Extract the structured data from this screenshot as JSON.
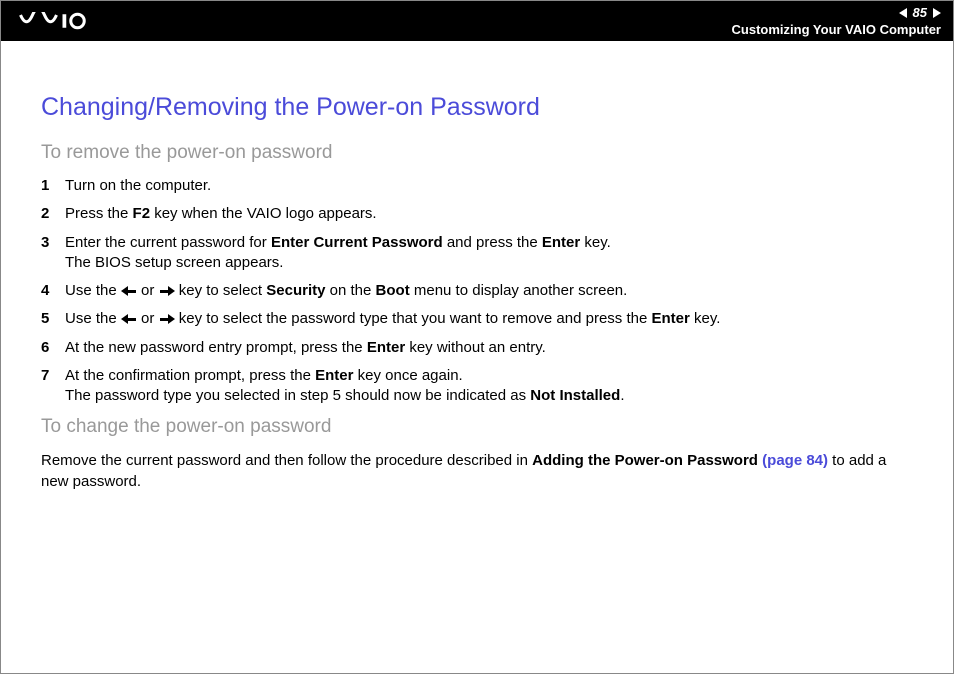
{
  "header": {
    "page_number": "85",
    "breadcrumb": "Customizing Your VAIO Computer"
  },
  "title": "Changing/Removing the Power-on Password",
  "section_remove": {
    "heading": "To remove the power-on password",
    "steps": [
      {
        "num": "1",
        "text": "Turn on the computer."
      },
      {
        "num": "2",
        "pre": "Press the ",
        "b1": "F2",
        "post": " key when the VAIO logo appears."
      },
      {
        "num": "3",
        "pre": "Enter the current password for ",
        "b1": "Enter Current Password",
        "mid": " and press the ",
        "b2": "Enter",
        "post": " key.",
        "line2": "The BIOS setup screen appears."
      },
      {
        "num": "4",
        "pre": "Use the ",
        "mid": " or ",
        "post": " key to select ",
        "b1": "Security",
        "mid2": " on the ",
        "b2": "Boot",
        "post2": " menu to display another screen."
      },
      {
        "num": "5",
        "pre": "Use the ",
        "mid": " or ",
        "post": " key to select the password type that you want to remove and press the ",
        "b1": "Enter",
        "post2": " key."
      },
      {
        "num": "6",
        "pre": "At the new password entry prompt, press the ",
        "b1": "Enter",
        "post": " key without an entry."
      },
      {
        "num": "7",
        "pre": "At the confirmation prompt, press the ",
        "b1": "Enter",
        "post": " key once again.",
        "line2_pre": "The password type you selected in step 5 should now be indicated as ",
        "line2_b": "Not Installed",
        "line2_post": "."
      }
    ]
  },
  "section_change": {
    "heading": "To change the power-on password",
    "para_pre": "Remove the current password and then follow the procedure described in ",
    "para_b": "Adding the Power-on Password ",
    "para_link": "(page 84)",
    "para_post": " to add a new password."
  }
}
